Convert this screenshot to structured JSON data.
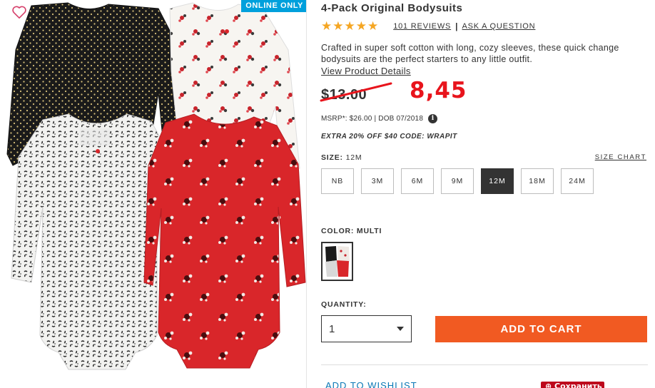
{
  "badge": "ONLINE ONLY",
  "product": {
    "title": "4-Pack Original Bodysuits",
    "stars": "★★★★★",
    "reviews": "101 REVIEWS",
    "separator": "|",
    "ask": "ASK A QUESTION",
    "description": "Crafted in super soft cotton with long, cozy sleeves, these quick change bodysuits are the perfect starters to any little outfit.",
    "details_link": "View Product Details"
  },
  "price": {
    "original": "$13.00",
    "annotation": "8,45",
    "msrp": "MSRP*: $26.00 | DOB 07/2018",
    "info_glyph": "i",
    "promo": "EXTRA 20% OFF $40 CODE: WRAPIT"
  },
  "size": {
    "label": "SIZE:",
    "selected": "12M",
    "chart_link": "SIZE CHART",
    "options": [
      "NB",
      "3M",
      "6M",
      "9M",
      "12M",
      "18M",
      "24M"
    ]
  },
  "color": {
    "label": "COLOR: MULTI"
  },
  "quantity": {
    "label": "QUANTITY:",
    "value": "1"
  },
  "actions": {
    "add_to_cart": "ADD TO CART",
    "wishlist": "ADD TO WISHLIST",
    "save": "⊕ Сохранить"
  },
  "colors": {
    "accent": "#f15a22",
    "badge": "#00a0dc",
    "annotation": "#e8141c",
    "link": "#0a78b5",
    "save": "#bd081c"
  }
}
